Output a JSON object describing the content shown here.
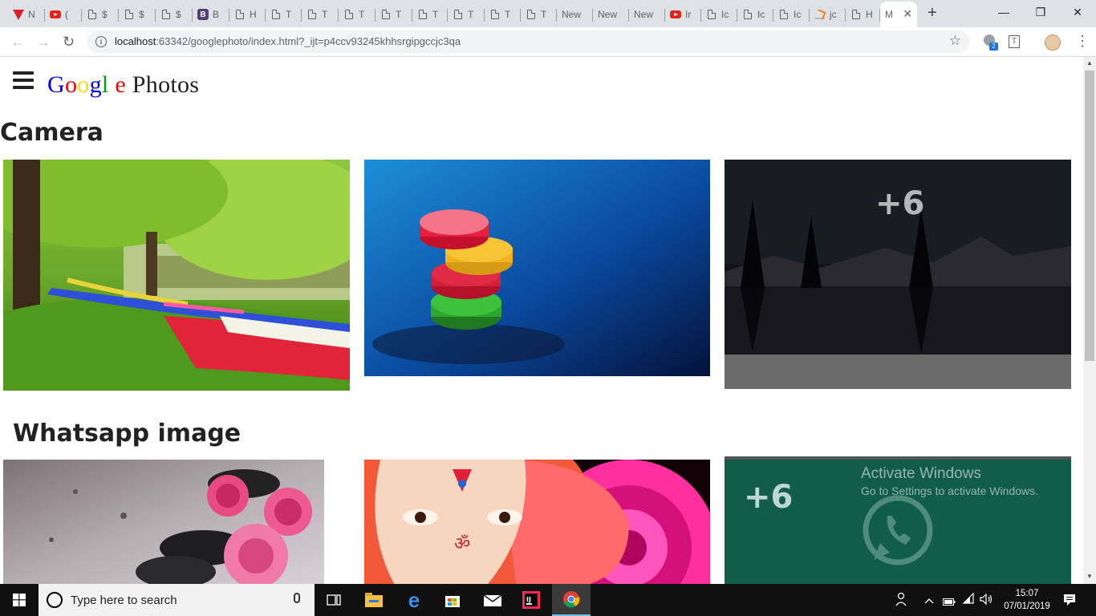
{
  "browser": {
    "tabs": [
      {
        "icon": "v-icon",
        "label": "N"
      },
      {
        "icon": "youtube-icon",
        "label": "("
      },
      {
        "icon": "doc-icon",
        "label": "$"
      },
      {
        "icon": "doc-icon",
        "label": "$"
      },
      {
        "icon": "doc-icon",
        "label": "$"
      },
      {
        "icon": "bootstrap-icon",
        "label": "B"
      },
      {
        "icon": "doc-icon",
        "label": "H"
      },
      {
        "icon": "doc-icon",
        "label": "T"
      },
      {
        "icon": "doc-icon",
        "label": "T"
      },
      {
        "icon": "doc-icon",
        "label": "T"
      },
      {
        "icon": "doc-icon",
        "label": "T"
      },
      {
        "icon": "doc-icon",
        "label": "T"
      },
      {
        "icon": "doc-icon",
        "label": "T"
      },
      {
        "icon": "doc-icon",
        "label": "T"
      },
      {
        "icon": "doc-icon",
        "label": "T"
      },
      {
        "icon": "none",
        "label": "New"
      },
      {
        "icon": "none",
        "label": "New"
      },
      {
        "icon": "none",
        "label": "New"
      },
      {
        "icon": "youtube-icon",
        "label": "Ir"
      },
      {
        "icon": "doc-icon",
        "label": "Ic"
      },
      {
        "icon": "doc-icon",
        "label": "Ic"
      },
      {
        "icon": "doc-icon",
        "label": "Ic"
      },
      {
        "icon": "stackoverflow-icon",
        "label": "jc"
      },
      {
        "icon": "doc-icon",
        "label": "H"
      }
    ],
    "active_tab": {
      "label": "M",
      "close": "✕"
    },
    "new_tab": "+",
    "window_controls": {
      "minimize": "—",
      "restore": "❐",
      "close": "✕"
    },
    "nav": {
      "back": "←",
      "forward": "→",
      "reload": "↻"
    },
    "url": {
      "host": "localhost",
      "rest": ":63342/googlephoto/index.html?_ijt=p4ccv93245khhsrgipgccjc3qa"
    },
    "bookmark": "☆",
    "menu": "⋮",
    "ext_badge": "2"
  },
  "page": {
    "logo": [
      {
        "ch": "G",
        "color": "#0000ff"
      },
      {
        "ch": "o",
        "color": "#ff0000"
      },
      {
        "ch": "o",
        "color": "#ffd700"
      },
      {
        "ch": "g",
        "color": "#0000ff"
      },
      {
        "ch": "l",
        "color": "#00a000"
      },
      {
        "ch": " ",
        "color": "#000000"
      },
      {
        "ch": "e",
        "color": "#ff0000"
      },
      {
        "ch": " Photos",
        "color": "#222222"
      }
    ],
    "sections": [
      {
        "title": "Camera",
        "more": "+6"
      },
      {
        "title": "Whatsapp image",
        "more": "+6"
      }
    ]
  },
  "watermark": {
    "line1": "Activate Windows",
    "line2": "Go to Settings to activate Windows."
  },
  "taskbar": {
    "search_placeholder": "Type here to search",
    "time": "15:07",
    "date": "07/01/2019"
  }
}
